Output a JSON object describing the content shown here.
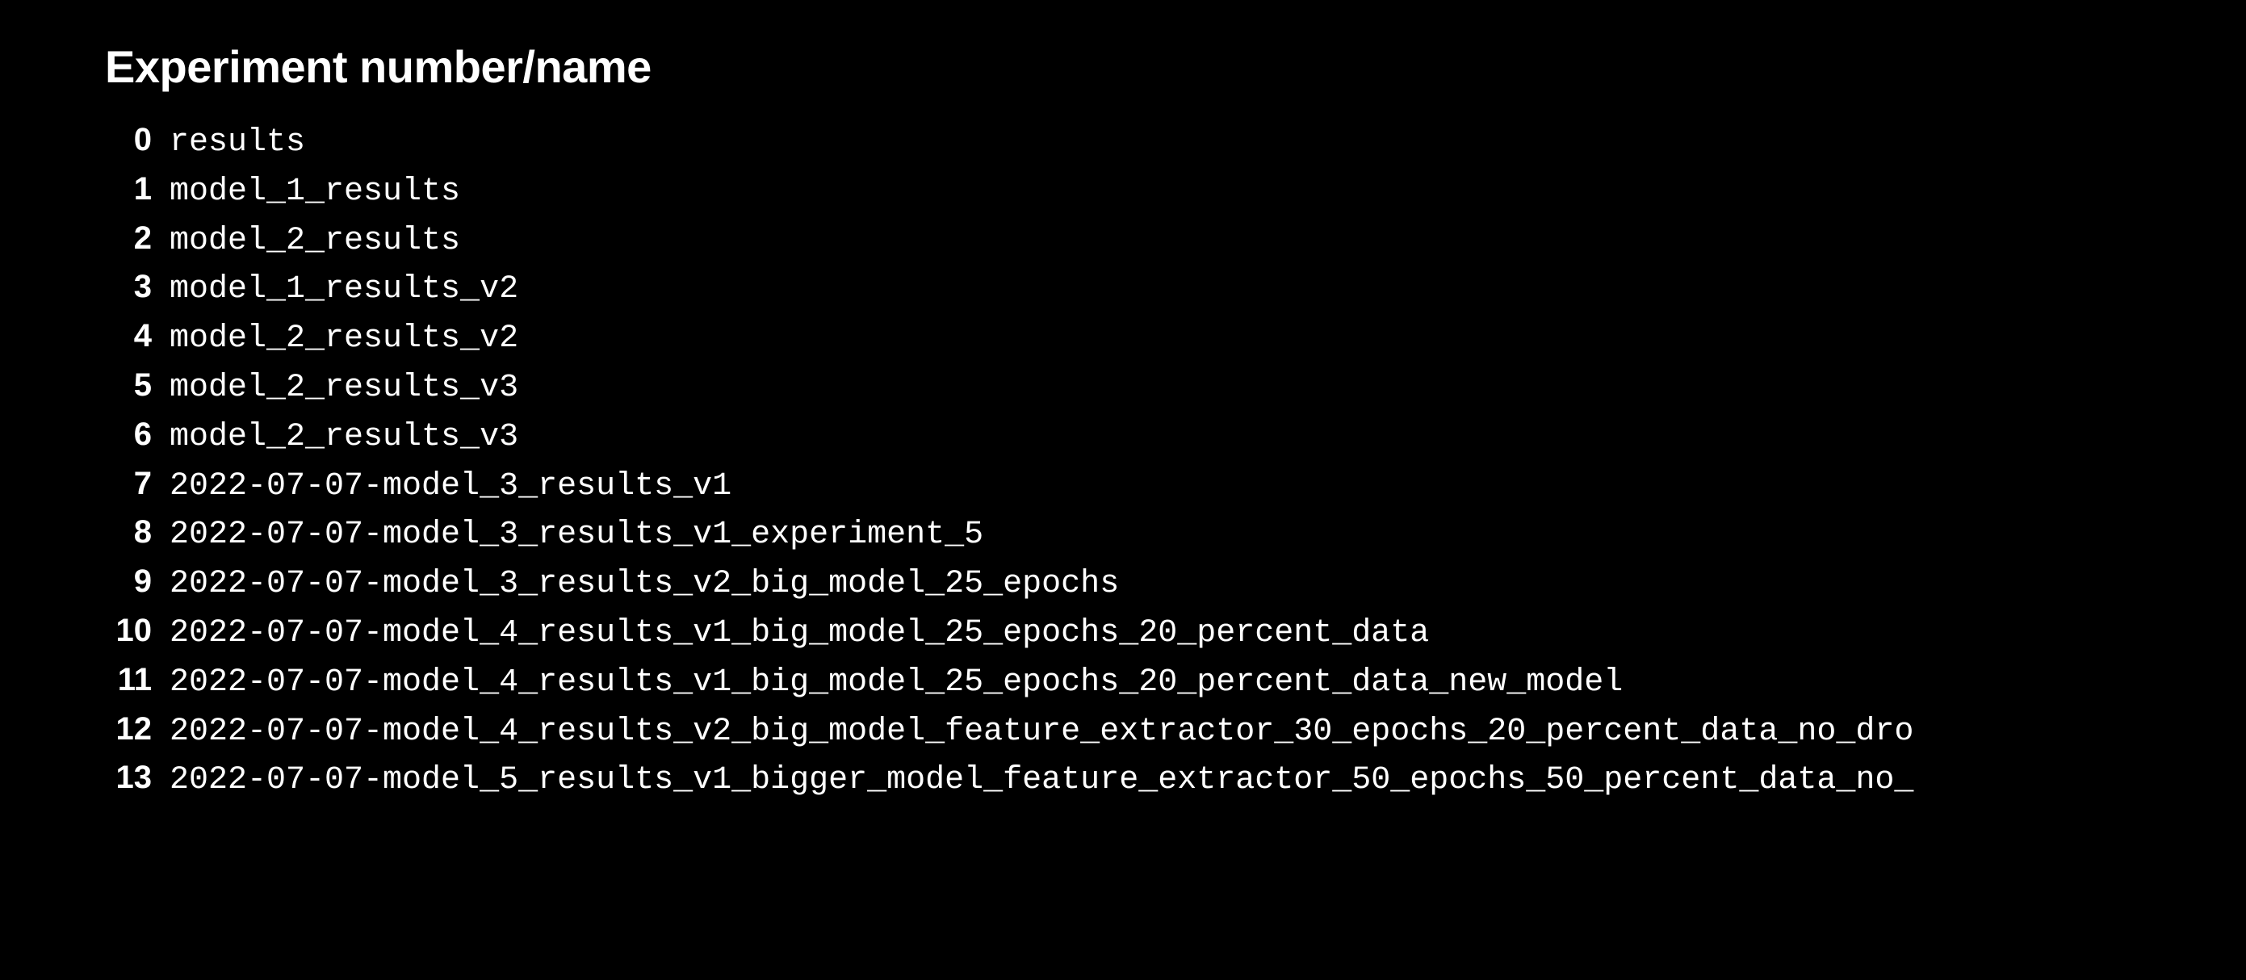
{
  "title": "Experiment number/name",
  "rows": [
    {
      "num": "0",
      "name": "results"
    },
    {
      "num": "1",
      "name": "model_1_results"
    },
    {
      "num": "2",
      "name": "model_2_results"
    },
    {
      "num": "3",
      "name": "model_1_results_v2"
    },
    {
      "num": "4",
      "name": "model_2_results_v2"
    },
    {
      "num": "5",
      "name": "model_2_results_v3"
    },
    {
      "num": "6",
      "name": "model_2_results_v3"
    },
    {
      "num": "7",
      "name": "2022-07-07-model_3_results_v1"
    },
    {
      "num": "8",
      "name": "2022-07-07-model_3_results_v1_experiment_5"
    },
    {
      "num": "9",
      "name": "2022-07-07-model_3_results_v2_big_model_25_epochs"
    },
    {
      "num": "10",
      "name": "2022-07-07-model_4_results_v1_big_model_25_epochs_20_percent_data"
    },
    {
      "num": "11",
      "name": "2022-07-07-model_4_results_v1_big_model_25_epochs_20_percent_data_new_model"
    },
    {
      "num": "12",
      "name": "2022-07-07-model_4_results_v2_big_model_feature_extractor_30_epochs_20_percent_data_no_dro"
    },
    {
      "num": "13",
      "name": "2022-07-07-model_5_results_v1_bigger_model_feature_extractor_50_epochs_50_percent_data_no_"
    }
  ]
}
